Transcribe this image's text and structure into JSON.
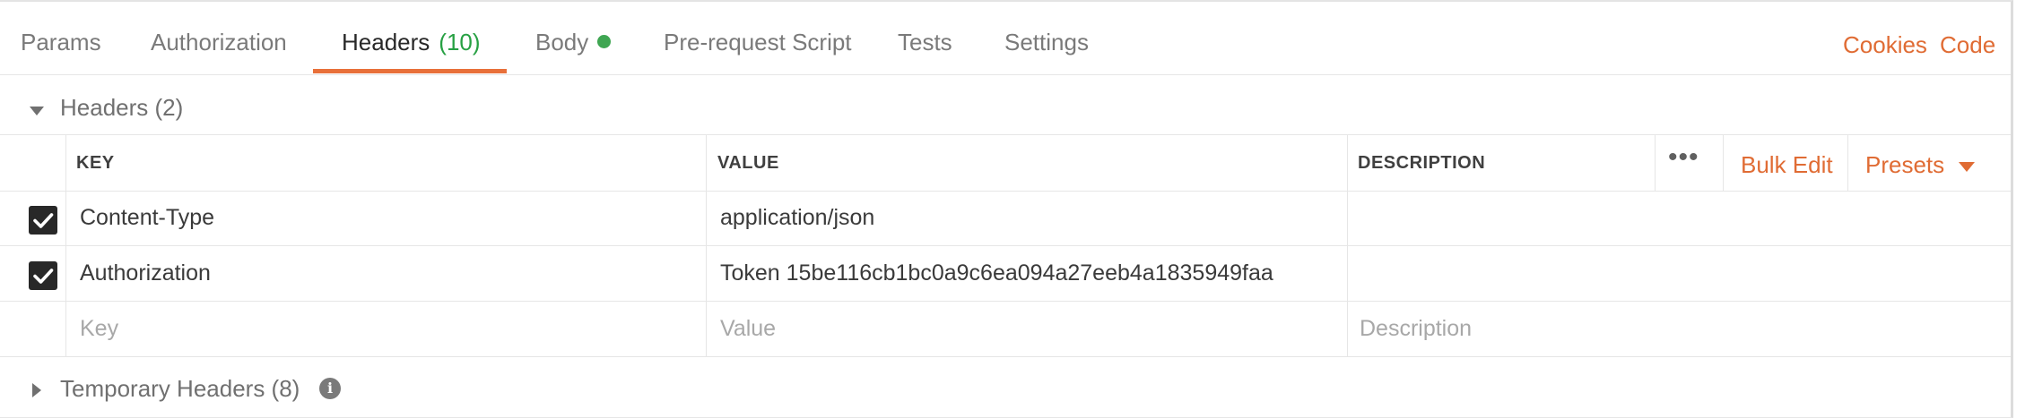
{
  "tabs": {
    "params": "Params",
    "authorization": "Authorization",
    "headers_label": "Headers",
    "headers_count": "(10)",
    "body": "Body",
    "prerequest": "Pre-request Script",
    "tests": "Tests",
    "settings": "Settings",
    "active": "Headers"
  },
  "right_links": {
    "cookies": "Cookies",
    "code": "Code"
  },
  "headers_section": {
    "title": "Headers",
    "count": "(2)",
    "expanded": true
  },
  "table": {
    "columns": {
      "key": "KEY",
      "value": "VALUE",
      "description": "DESCRIPTION"
    },
    "actions": {
      "more": "•••",
      "bulk_edit": "Bulk Edit",
      "presets": "Presets"
    },
    "rows": [
      {
        "checked": true,
        "key": "Content-Type",
        "value": "application/json",
        "description": ""
      },
      {
        "checked": true,
        "key": "Authorization",
        "value": "Token 15be116cb1bc0a9c6ea094a27eeb4a1835949faa",
        "description": ""
      }
    ],
    "placeholders": {
      "key": "Key",
      "value": "Value",
      "description": "Description"
    }
  },
  "temporary_section": {
    "title": "Temporary Headers",
    "count": "(8)",
    "expanded": false,
    "info_icon": "i"
  },
  "colors": {
    "accent": "#e8703a",
    "link": "#e06c34",
    "count_green": "#27a043",
    "body_dot": "#3fa652"
  },
  "icons": [
    "checkbox-checked-icon",
    "caret-down-icon",
    "caret-right-icon",
    "info-icon",
    "chevron-down-icon",
    "more-icon"
  ]
}
